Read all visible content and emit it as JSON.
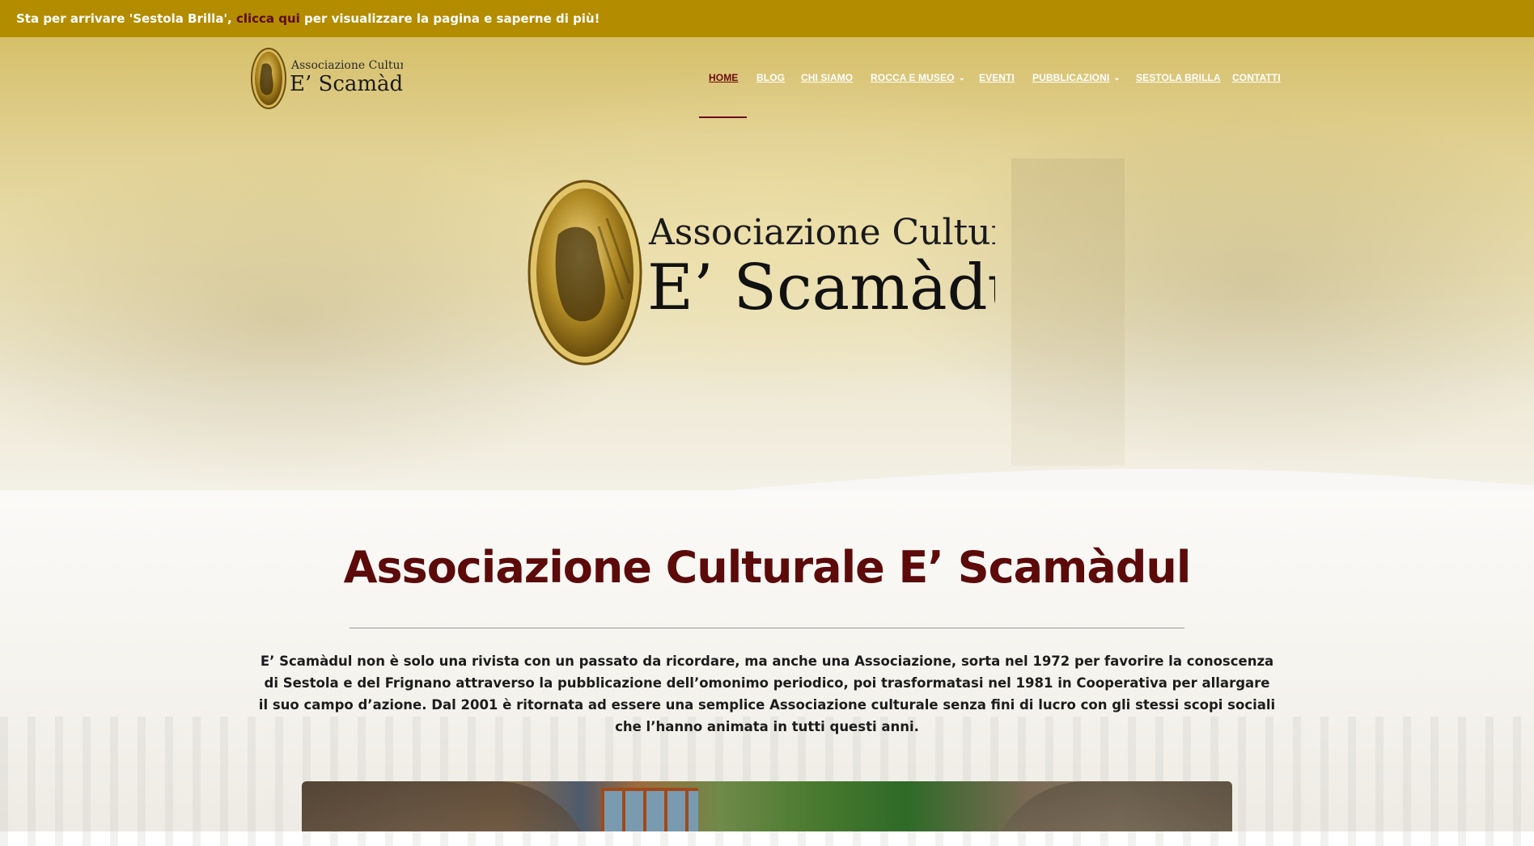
{
  "announcement": {
    "prefix": "Sta per arrivare 'Sestola Brilla', ",
    "link_text": "clicca qui",
    "suffix": " per visualizzare la pagina e saperne di più!"
  },
  "logo": {
    "line1": "Associazione Culturale",
    "line2": "E’ Scamàdul"
  },
  "nav": {
    "items": [
      {
        "label": "HOME",
        "active": true
      },
      {
        "label": "BLOG"
      },
      {
        "label": "CHI SIAMO"
      },
      {
        "label": "ROCCA E MUSEO",
        "dropdown": true
      },
      {
        "label": "EVENTI"
      },
      {
        "label": "PUBBLICAZIONI",
        "dropdown": true
      },
      {
        "label": "SESTOLA BRILLA"
      },
      {
        "label": "CONTATTI"
      }
    ]
  },
  "main": {
    "title": "Associazione Culturale E’ Scamàdul",
    "description": "E’ Scamàdul non è solo una rivista con un passato da ricordare, ma anche una Associazione, sorta nel 1972 per favorire la conoscenza di Sestola e del Frignano attraverso la pubblicazione dell’omonimo periodico, poi trasformatasi nel 1981 in Cooperativa per allargare il suo campo d’azione. Dal 2001 è ritornata ad essere una semplice Associazione culturale senza fini di lucro con gli stessi scopi sociali che l’hanno animata in tutti questi anni."
  },
  "colors": {
    "topbar": "#b38c00",
    "brand_maroon": "#5c0a0a",
    "nav_active": "#6b0a0a"
  }
}
